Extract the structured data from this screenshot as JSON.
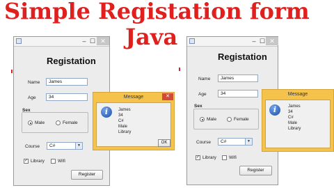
{
  "title": {
    "line1": "Simple Registation form",
    "line2": "Java"
  },
  "form": {
    "heading": "Registation",
    "name_label": "Name",
    "name_value": "James",
    "age_label": "Age",
    "age_value": "34",
    "sex_label": "Sex",
    "male_label": "Male",
    "female_label": "Female",
    "selected_sex": "Male",
    "course_label": "Course",
    "course_value": "C#",
    "library_label": "Library",
    "library_checked": true,
    "wifi_label": "Wifi",
    "wifi_checked": false,
    "register_label": "Register",
    "window_controls": {
      "minimize": "–",
      "maximize": "☐",
      "close": "✕"
    }
  },
  "message": {
    "title": "Message",
    "close": "✕",
    "lines": [
      "James",
      "34",
      "C#",
      "Male",
      "Library"
    ],
    "ok_label": "OK",
    "icon": "info-icon"
  },
  "colors": {
    "title_red": "#e0201e",
    "dialog_frame": "#f5c24c",
    "info_blue": "#1f4fa8"
  }
}
